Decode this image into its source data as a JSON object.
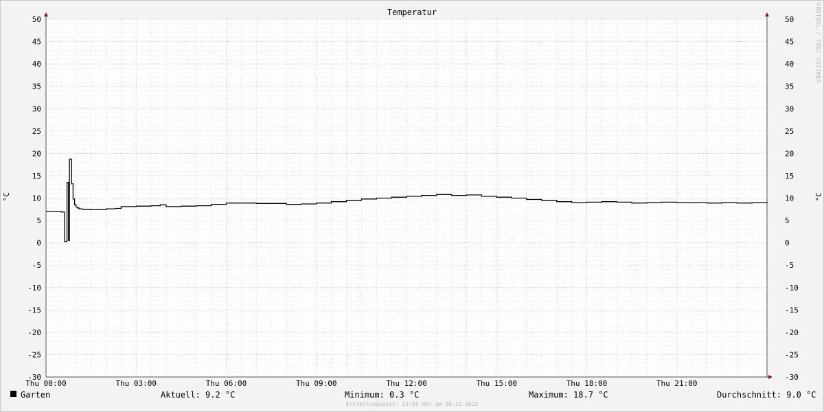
{
  "chart_data": {
    "type": "line",
    "title": "Temperatur",
    "ylabel": "°C",
    "ylim": [
      -30,
      50
    ],
    "y_ticks": [
      "50",
      "45",
      "40",
      "35",
      "30",
      "25",
      "20",
      "15",
      "10",
      "5",
      "0",
      "-5",
      "-10",
      "-15",
      "-20",
      "-25",
      "-30"
    ],
    "x_ticks": [
      "Thu 00:00",
      "Thu 03:00",
      "Thu 06:00",
      "Thu 09:00",
      "Thu 12:00",
      "Thu 15:00",
      "Thu 18:00",
      "Thu 21:00"
    ],
    "xlim_hours": [
      0,
      24
    ],
    "grid": true,
    "series": [
      {
        "name": "Garten",
        "color": "#000000",
        "x_hours": [
          0,
          0.5,
          0.6,
          0.62,
          0.7,
          0.75,
          0.78,
          0.85,
          0.9,
          0.95,
          1.0,
          1.05,
          1.1,
          1.2,
          1.5,
          2.0,
          2.3,
          2.5,
          3.0,
          3.5,
          3.8,
          4.0,
          4.5,
          5.0,
          5.5,
          6.0,
          7.0,
          8.0,
          8.5,
          9.0,
          9.5,
          10.0,
          10.5,
          11.0,
          11.5,
          12.0,
          12.5,
          13.0,
          13.5,
          14.0,
          14.5,
          15.0,
          15.5,
          16.0,
          16.5,
          17.0,
          17.5,
          18.0,
          18.5,
          19.0,
          19.5,
          20.0,
          20.5,
          21.0,
          21.5,
          22.0,
          22.5,
          23.0,
          23.5,
          24.0
        ],
        "y_values": [
          7.0,
          6.9,
          6.9,
          0.3,
          13.5,
          0.5,
          18.7,
          13.2,
          9.8,
          8.5,
          8.0,
          7.8,
          7.6,
          7.5,
          7.4,
          7.6,
          7.7,
          8.1,
          8.2,
          8.3,
          8.5,
          8.1,
          8.2,
          8.3,
          8.6,
          8.9,
          8.8,
          8.6,
          8.7,
          8.9,
          9.2,
          9.5,
          9.8,
          10.0,
          10.2,
          10.4,
          10.6,
          10.8,
          10.6,
          10.7,
          10.4,
          10.2,
          10.0,
          9.7,
          9.5,
          9.2,
          9.0,
          9.1,
          9.2,
          9.1,
          8.9,
          9.0,
          9.1,
          9.0,
          9.0,
          8.9,
          9.0,
          8.9,
          9.0,
          9.2
        ]
      }
    ]
  },
  "title": "Temperatur",
  "unit_left": "°C",
  "unit_right": "°C",
  "watermark": "RRDTOOL / TOBI OETIKER",
  "legend": {
    "series_name": "Garten",
    "aktuell": "Aktuell: 9.2 °C",
    "minimum": "Minimum: 0.3 °C",
    "maximum": "Maximum: 18.7 °C",
    "durchschnitt": "Durchschnitt: 9.0 °C"
  },
  "created": "Erstellungszeit: 23:55 Uhr am 28.12.2023"
}
